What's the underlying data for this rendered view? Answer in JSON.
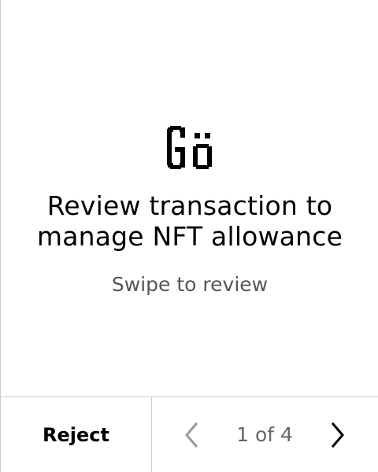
{
  "review": {
    "logo_icon": "go-ledger-logo",
    "title": "Review transaction to manage NFT allowance",
    "subtitle": "Swipe to review"
  },
  "footer": {
    "reject_label": "Reject",
    "page_indicator": "1 of 4",
    "current_page": 1,
    "total_pages": 4,
    "prev_icon": "chevron-left-icon",
    "next_icon": "chevron-right-icon"
  },
  "colors": {
    "text": "#000000",
    "secondary_text": "#555555",
    "disabled": "#999999",
    "divider": "#cccccc",
    "background": "#ffffff"
  }
}
